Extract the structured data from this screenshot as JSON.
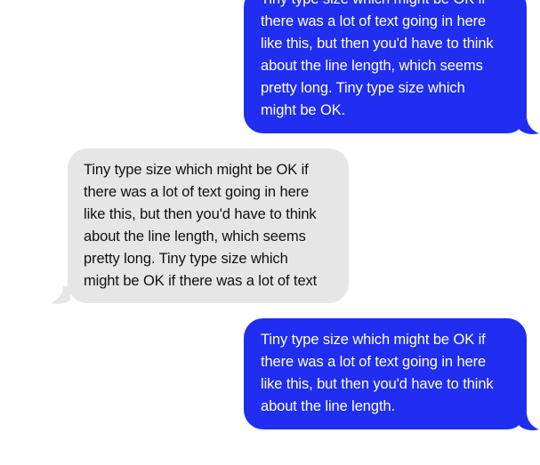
{
  "colors": {
    "sent_bubble": "#1f2ef0",
    "sent_text": "#ffffff",
    "received_bubble": "#e6e6e6",
    "received_text": "#111111",
    "background": "#ffffff"
  },
  "messages": [
    {
      "direction": "sent",
      "text": "Tiny type size which might be OK if\nthere was a lot of text going in here\nlike this, but then you'd have to think\nabout the line length, which seems\npretty long. Tiny type size which\nmight be OK."
    },
    {
      "direction": "received",
      "text": "Tiny type size which might be OK if\nthere was a lot of text going in here\nlike this, but then you'd have to think\nabout the line length, which seems\npretty long. Tiny type size which\nmight be OK if there was a lot of text"
    },
    {
      "direction": "sent",
      "text": "Tiny type size which might be OK if\nthere was a lot of text going in here\nlike this, but then you'd have to think\nabout the line length."
    }
  ]
}
